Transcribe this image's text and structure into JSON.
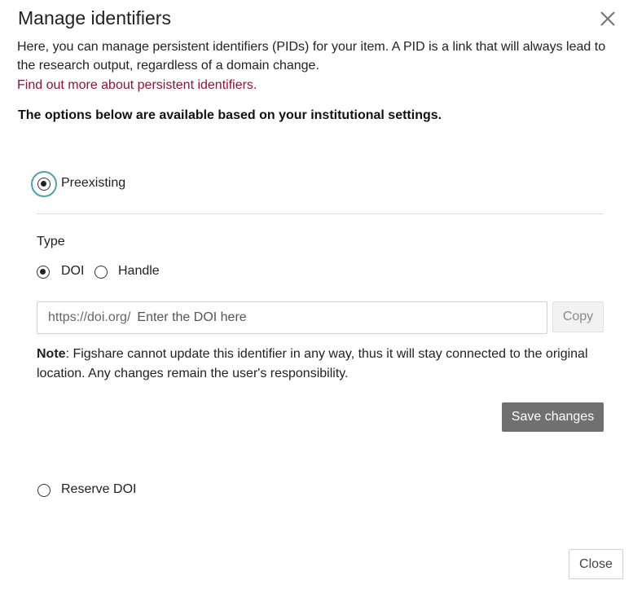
{
  "dialog": {
    "title": "Manage identifiers",
    "close_icon": "close-icon",
    "intro": "Here, you can manage persistent identifiers (PIDs) for your item. A PID is a link that will always lead to the research output, regardless of a domain change.",
    "learn_more_link": "Find out more about persistent identifiers.",
    "notice": "The options below are available based on your institutional settings."
  },
  "options": {
    "preexisting": {
      "label": "Preexisting",
      "selected": true
    },
    "reserve_doi": {
      "label": "Reserve DOI",
      "selected": false
    }
  },
  "type_section": {
    "label": "Type",
    "types": [
      {
        "label": "DOI",
        "selected": true
      },
      {
        "label": "Handle",
        "selected": false
      }
    ],
    "input": {
      "prefix": "https://doi.org/",
      "placeholder": "Enter the DOI here",
      "value": ""
    },
    "copy_label": "Copy",
    "note_label": "Note",
    "note_text": ": Figshare cannot update this identifier in any way, thus it will stay connected to the original location. Any changes remain the user's responsibility.",
    "save_label": "Save changes"
  },
  "footer": {
    "close_label": "Close"
  },
  "colors": {
    "link": "#8a1538",
    "focus_ring": "#4aa3ad",
    "save_button_bg": "#707070"
  }
}
